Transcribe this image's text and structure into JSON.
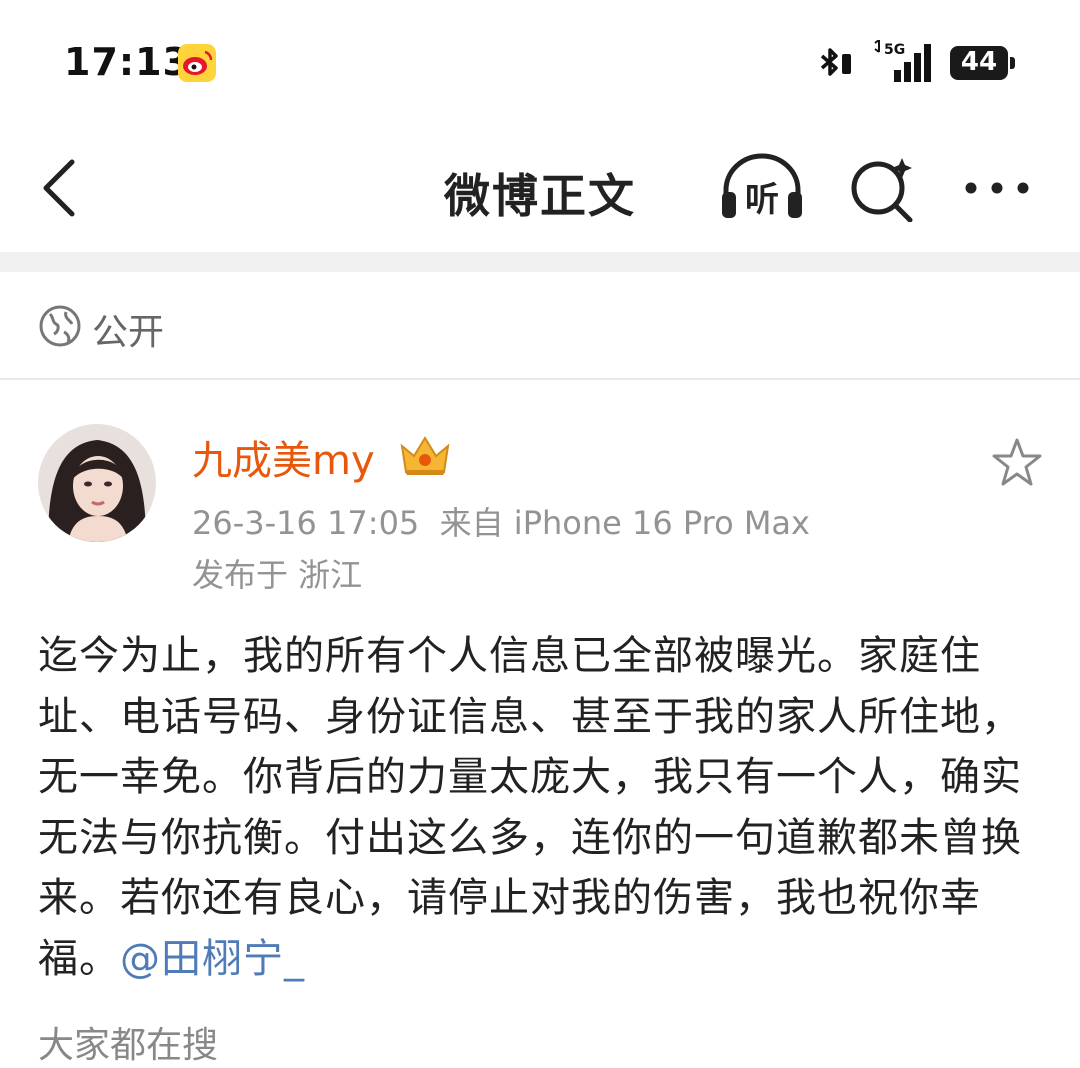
{
  "status_bar": {
    "time": "17:13",
    "battery": "44"
  },
  "nav": {
    "title": "微博正文",
    "listen_label": "听"
  },
  "visibility": "公开",
  "post": {
    "username": "九成美my",
    "timestamp": "26-3-16 17:05",
    "source": "来自 iPhone 16 Pro Max",
    "location": "发布于 浙江",
    "text": "迄今为止，我的所有个人信息已全部被曝光。家庭住址、电话号码、身份证信息、甚至于我的家人所住地，无一幸免。你背后的力量太庞大，我只有一个人，确实无法与你抗衡。付出这么多，连你的一句道歉都未曾换来。若你还有良心，请停止对我的伤害，我也祝你幸福。",
    "mention": "@田栩宁_"
  },
  "trending_label": "大家都在搜",
  "colors": {
    "username": "#e8580c",
    "mention": "#4f7cb7",
    "meta": "#939393"
  }
}
